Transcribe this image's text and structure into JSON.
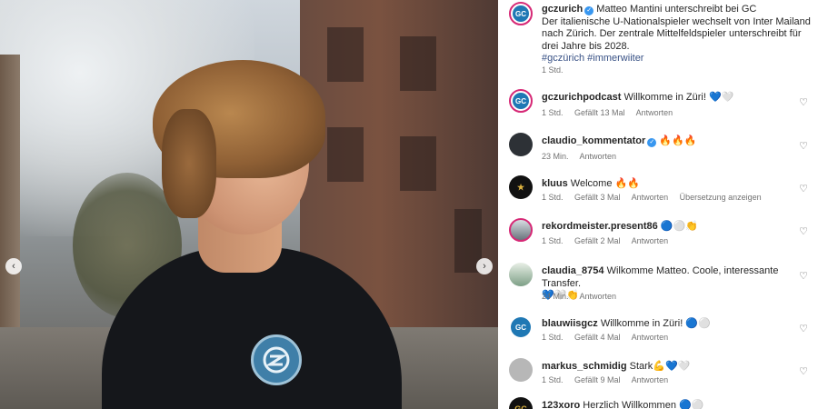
{
  "post": {
    "author": "gczurich",
    "headline": "Matteo Mantini unterschreibt bei GC",
    "body": "Der italienische U-Nationalspieler wechselt von Inter Mailand nach Zürich. Der zentrale Mittelfeldspieler unterschreibt für drei Jahre bis 2028.",
    "hashtags": "#gczürich #immerwiiter",
    "time": "1 Std.",
    "avatar_text": "GC"
  },
  "comments": [
    {
      "user": "gczurichpodcast",
      "text": "Willkomme in Züri! 💙🤍",
      "time": "1 Std.",
      "likes": "Gefällt 13 Mal",
      "reply": "Antworten",
      "avatar": "GC"
    },
    {
      "user": "claudio_kommentator",
      "text": "🔥🔥🔥",
      "time": "23 Min.",
      "reply": "Antworten",
      "verified": true
    },
    {
      "user": "kluus",
      "text": "Welcome 🔥🔥",
      "time": "1 Std.",
      "likes": "Gefällt 3 Mal",
      "reply": "Antworten",
      "translate": "Übersetzung anzeigen"
    },
    {
      "user": "rekordmeister.present86",
      "text": "🔵⚪👏",
      "time": "1 Std.",
      "likes": "Gefällt 2 Mal",
      "reply": "Antworten"
    },
    {
      "user": "claudia_8754",
      "text": "Wilkomme Matteo. Coole, interessante Transfer.",
      "text2": "💙🤍👏",
      "time": "24 Min.",
      "reply": "Antworten"
    },
    {
      "user": "blauwiisgcz",
      "text": "Willkomme in Züri! 🔵⚪",
      "time": "1 Std.",
      "likes": "Gefällt 4 Mal",
      "reply": "Antworten",
      "avatar": "GC"
    },
    {
      "user": "markus_schmidig",
      "text": "Stark💪💙🤍",
      "time": "1 Std.",
      "likes": "Gefällt 9 Mal",
      "reply": "Antworten"
    },
    {
      "user": "123xoro",
      "text": "Herzlich Willkommen 🔵⚪",
      "avatar": "GC"
    }
  ],
  "icons": {
    "heart": "heart-outline-icon",
    "prev": "chevron-left-icon",
    "next": "chevron-right-icon",
    "verified": "verified-badge-icon"
  },
  "colors": {
    "link": "#385185",
    "verified": "#3897f0",
    "meta": "#737373",
    "gc_blue": "#1f78b4"
  }
}
